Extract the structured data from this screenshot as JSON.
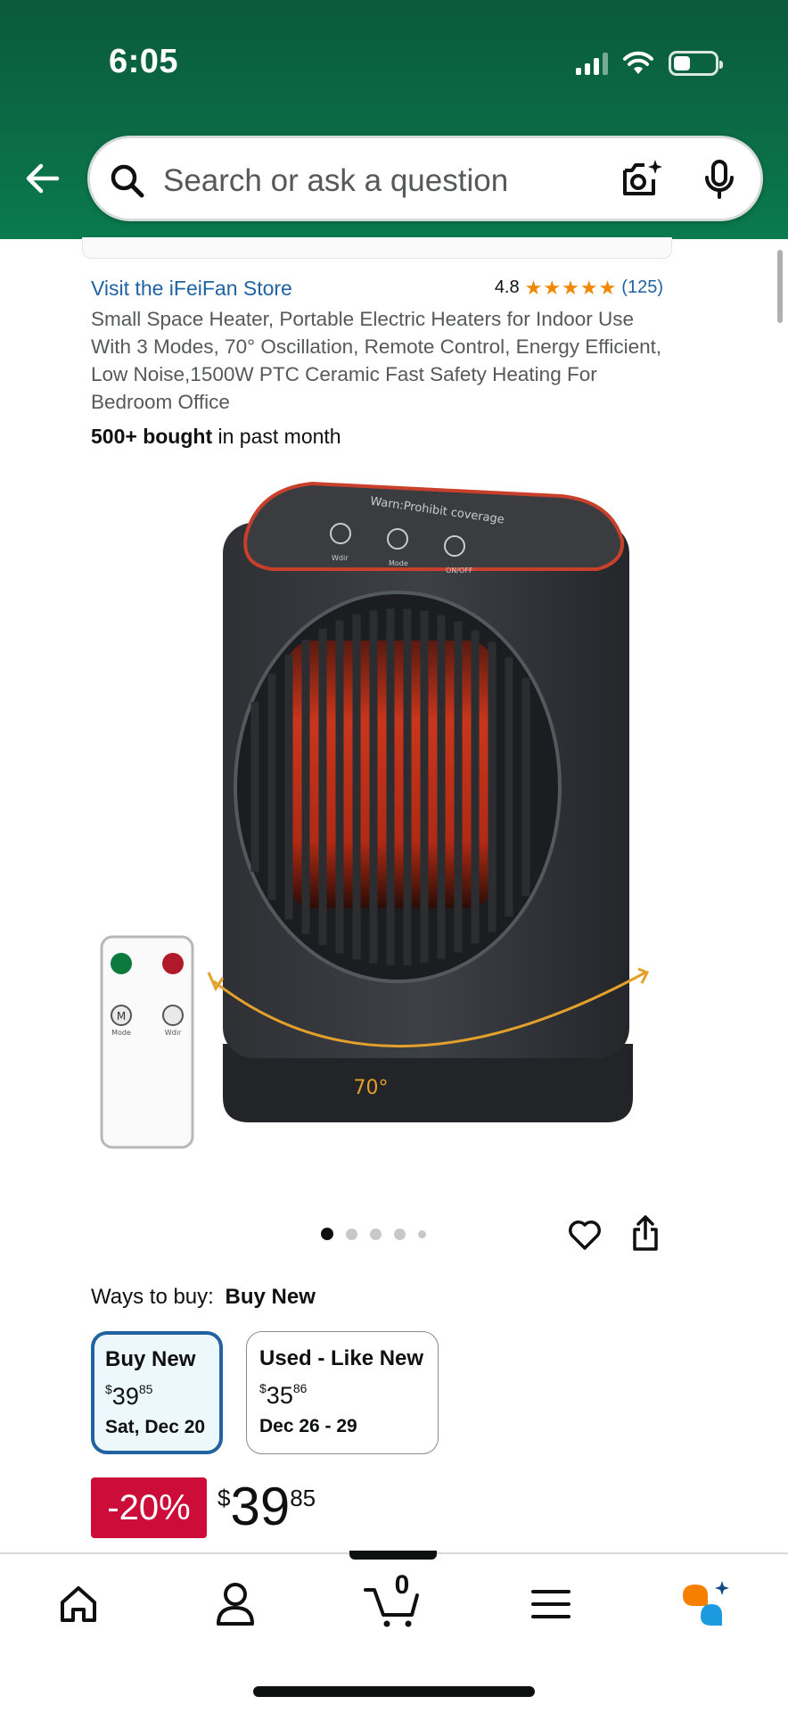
{
  "status_bar": {
    "time": "6:05"
  },
  "search": {
    "placeholder": "Search or ask a question"
  },
  "product": {
    "store_link": "Visit the iFeiFan Store",
    "rating": "4.8",
    "rating_count": "(125)",
    "title": "Small Space Heater, Portable Electric Heaters for Indoor Use With 3 Modes, 70° Oscillation, Remote Control, Energy Efficient, Low Noise,1500W PTC Ceramic Fast Safety Heating For Bedroom Office",
    "bought_bold": "500+ bought",
    "bought_rest": " in past month",
    "image_texts": {
      "top_panel": "Warn:Prohibit coverage",
      "btn_wdir": "Wdir",
      "btn_mode": "Mode",
      "btn_onoff": "ON/OFF",
      "angle": "70°",
      "remote_m": "M",
      "remote_mode": "Mode",
      "remote_wdir": "Wdir"
    },
    "carousel": {
      "count": 5,
      "active": 0
    }
  },
  "ways_to_buy": {
    "label": "Ways to buy:",
    "selected": "Buy New",
    "options": [
      {
        "title": "Buy New",
        "currency": "$",
        "whole": "39",
        "fraction": "85",
        "date": "Sat, Dec 20"
      },
      {
        "title": "Used - Like New",
        "currency": "$",
        "whole": "35",
        "fraction": "86",
        "date": "Dec 26 - 29"
      }
    ]
  },
  "price": {
    "discount": "-20%",
    "currency": "$",
    "whole": "39",
    "fraction": "85"
  },
  "bottom_nav": {
    "items": [
      "home-icon",
      "account-icon",
      "cart-icon",
      "menu-icon",
      "rufus-icon"
    ],
    "cart_count": "0"
  },
  "colors": {
    "header_green": "#0b6b45",
    "link_blue": "#2162a1",
    "star_orange": "#f08804",
    "deal_red": "#cc0c39"
  }
}
